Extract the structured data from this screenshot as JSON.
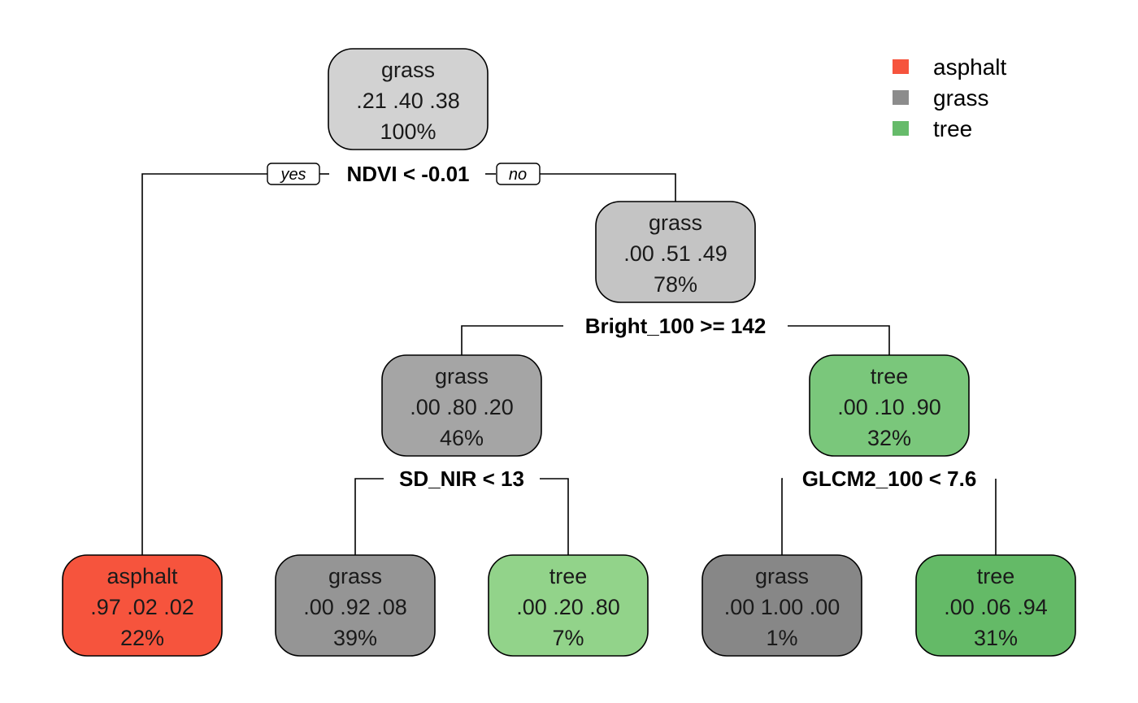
{
  "legend": {
    "placement": "top-right",
    "items": [
      {
        "label": "asphalt",
        "color": "#F6543D"
      },
      {
        "label": "grass",
        "color": "#8C8C8C"
      },
      {
        "label": "tree",
        "color": "#66BB6A"
      }
    ]
  },
  "edge_labels": {
    "yes": "yes",
    "no": "no"
  },
  "nodes": [
    {
      "id": "n1",
      "class": "grass",
      "probs": [
        ".21",
        ".40",
        ".38"
      ],
      "pct": "100%",
      "fill": "#D2D2D2",
      "split": "NDVI < -0.01",
      "children": [
        "n2",
        "n3"
      ]
    },
    {
      "id": "n2",
      "class": "asphalt",
      "probs": [
        ".97",
        ".02",
        ".02"
      ],
      "pct": "22%",
      "fill": "#F6543D",
      "split": "",
      "children": []
    },
    {
      "id": "n3",
      "class": "grass",
      "probs": [
        ".00",
        ".51",
        ".49"
      ],
      "pct": "78%",
      "fill": "#C4C4C4",
      "split": "Bright_100 >= 142",
      "children": [
        "n4",
        "n5"
      ]
    },
    {
      "id": "n4",
      "class": "grass",
      "probs": [
        ".00",
        ".80",
        ".20"
      ],
      "pct": "46%",
      "fill": "#A5A5A5",
      "split": "SD_NIR < 13",
      "children": [
        "n6",
        "n7"
      ]
    },
    {
      "id": "n5",
      "class": "tree",
      "probs": [
        ".00",
        ".10",
        ".90"
      ],
      "pct": "32%",
      "fill": "#7AC77B",
      "split": "GLCM2_100 < 7.6",
      "children": [
        "n8",
        "n9"
      ]
    },
    {
      "id": "n6",
      "class": "grass",
      "probs": [
        ".00",
        ".92",
        ".08"
      ],
      "pct": "39%",
      "fill": "#959595",
      "split": "",
      "children": []
    },
    {
      "id": "n7",
      "class": "tree",
      "probs": [
        ".00",
        ".20",
        ".80"
      ],
      "pct": "7%",
      "fill": "#92D38A",
      "split": "",
      "children": []
    },
    {
      "id": "n8",
      "class": "grass",
      "probs": [
        ".00",
        "1.00",
        ".00"
      ],
      "pct": "1%",
      "fill": "#878787",
      "split": "",
      "children": []
    },
    {
      "id": "n9",
      "class": "tree",
      "probs": [
        ".00",
        ".06",
        ".94"
      ],
      "pct": "31%",
      "fill": "#64BA67",
      "split": "",
      "children": []
    }
  ]
}
